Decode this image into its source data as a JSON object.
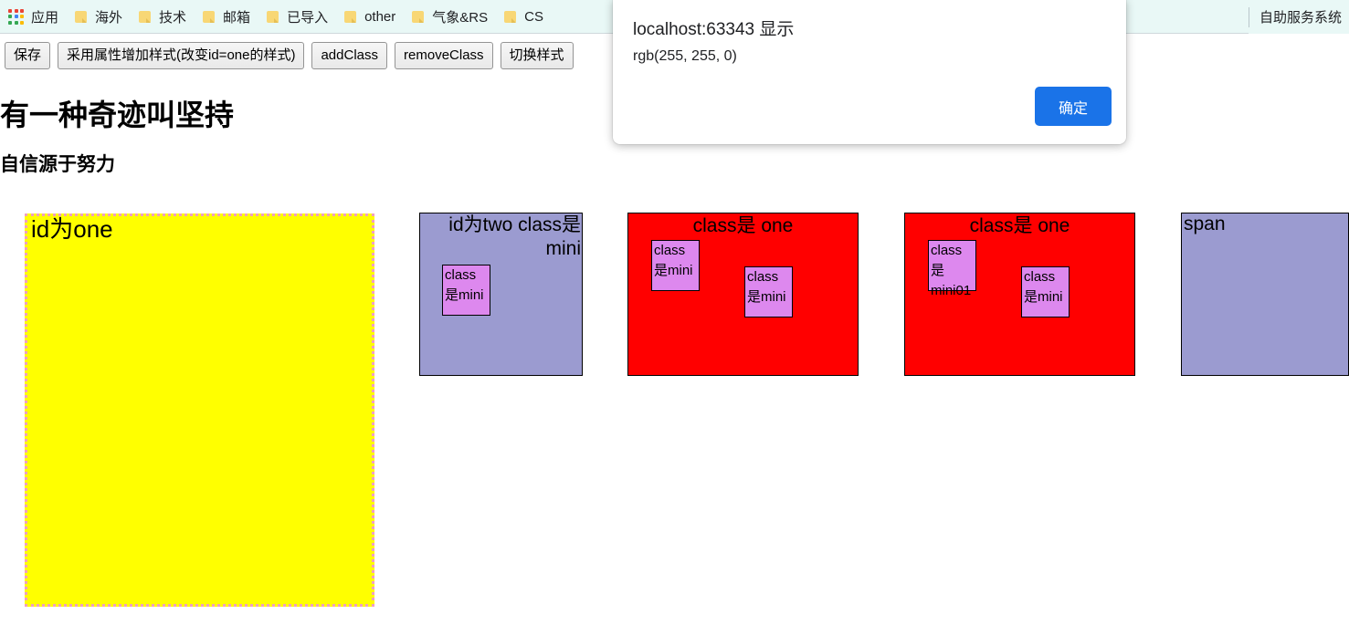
{
  "bookmarks_bar": {
    "apps": {
      "icon": "apps-grid-icon",
      "label": "应用",
      "grid_colors": [
        "#ea4335",
        "#ea4335",
        "#ea4335",
        "#34a853",
        "#4285f4",
        "#fbbc05",
        "#34a853",
        "#34a853",
        "#fbbc05"
      ]
    },
    "items": [
      {
        "icon": "folder-icon",
        "label": "海外"
      },
      {
        "icon": "folder-icon",
        "label": "技术"
      },
      {
        "icon": "folder-icon",
        "label": "邮箱"
      },
      {
        "icon": "folder-icon",
        "label": "已导入"
      },
      {
        "icon": "folder-icon",
        "label": "other"
      },
      {
        "icon": "folder-icon",
        "label": "气象&RS"
      },
      {
        "icon": "folder-icon",
        "label": "CS"
      }
    ],
    "right_item": {
      "label": "自助服务系统"
    },
    "background": "#e9f8f6"
  },
  "toolbar": {
    "buttons": [
      {
        "label": "保存"
      },
      {
        "label": "采用属性增加样式(改变id=one的样式)"
      },
      {
        "label": "addClass"
      },
      {
        "label": "removeClass"
      },
      {
        "label": "切换样式"
      }
    ]
  },
  "page": {
    "h1": "有一种奇迹叫坚持",
    "h3": "自信源于努力"
  },
  "boxes": {
    "one": {
      "label": "id为one",
      "background": "#ffff00",
      "border_color": "#f0a0c0"
    },
    "two": {
      "label": "id为two class是mini",
      "background": "#9b9bd0",
      "mini": {
        "label": "class是mini"
      }
    },
    "three": {
      "label": "class是 one",
      "background": "#ff0000",
      "mini_a": {
        "label": "class是mini"
      },
      "mini_b": {
        "label": "class是mini"
      }
    },
    "four": {
      "label": "class是 one",
      "background": "#ff0000",
      "mini_a": {
        "label": "class是mini01"
      },
      "mini_b": {
        "label": "class是mini"
      }
    },
    "span": {
      "label": "span",
      "background": "#9b9bd0"
    }
  },
  "dialog": {
    "origin": "localhost:63343 显示",
    "message": "rgb(255, 255, 0)",
    "ok_label": "确定",
    "accent": "#1a73e8"
  }
}
